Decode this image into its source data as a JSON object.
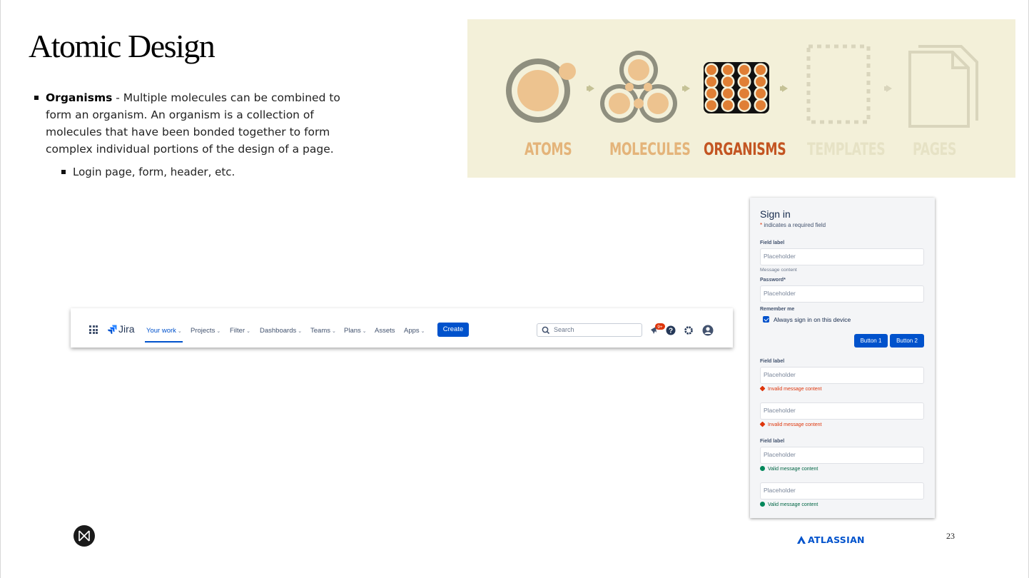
{
  "slide": {
    "title": "Atomic Design",
    "page_number": "23",
    "footer_brand": "ATLASSIAN"
  },
  "bullets": {
    "main_term": "Organisms",
    "main_text": " - Multiple molecules can be combined to form an organism. An organism is a collection of molecules that have been bonded together to form complex individual portions of the design of a page.",
    "sub_text": "Login page, form, header, etc."
  },
  "diagram": {
    "labels": [
      "ATOMS",
      "MOLECULES",
      "ORGANISMS",
      "TEMPLATES",
      "PAGES"
    ],
    "colors": {
      "background": "#f3f0d9",
      "gray": "#8f8f7f",
      "peach": "#edc38f",
      "orange": "#e07f35",
      "faded": "#d9d5bc",
      "arrow": "#c5c296",
      "label_atoms": "#e4b47a",
      "label_organisms": "#c35522",
      "label_faded": "#e6e2c5"
    }
  },
  "jira_nav": {
    "logo": "Jira",
    "items": [
      "Your work",
      "Projects",
      "Filter",
      "Dashboards",
      "Teams",
      "Plans",
      "Assets",
      "Apps"
    ],
    "create_label": "Create",
    "search_placeholder": "Search",
    "notification_badge": "9+",
    "icons": [
      "app-switcher-icon",
      "jira-logo-icon",
      "search-icon",
      "notification-icon",
      "help-icon",
      "settings-icon",
      "profile-icon"
    ],
    "colors": {
      "primary": "#0052cc",
      "text": "#42526e",
      "badge": "#de350b"
    }
  },
  "signin_form": {
    "title": "Sign in",
    "required_star": "*",
    "required_note": " indicates a required field",
    "field1_label": "Field label",
    "field1_placeholder": "Placeholder",
    "field1_message": "Message content",
    "password_label": "Password*",
    "password_placeholder": "Placeholder",
    "remember_label": "Remember me",
    "remember_checkbox": "Always sign in on this device",
    "button1": "Button 1",
    "button2": "Button 2",
    "field3_label": "Field label",
    "field3_placeholder": "Placeholder",
    "field3_error": "Invalid message content",
    "field4_placeholder": "Placeholder",
    "field4_error": "Invalid message content",
    "field5_label": "Field label",
    "field5_placeholder": "Placeholder",
    "field5_valid": "Valid message content",
    "field6_placeholder": "Placeholder",
    "field6_valid": "Valid message content",
    "colors": {
      "error": "#de350b",
      "success": "#006644",
      "button": "#0052cc"
    }
  }
}
